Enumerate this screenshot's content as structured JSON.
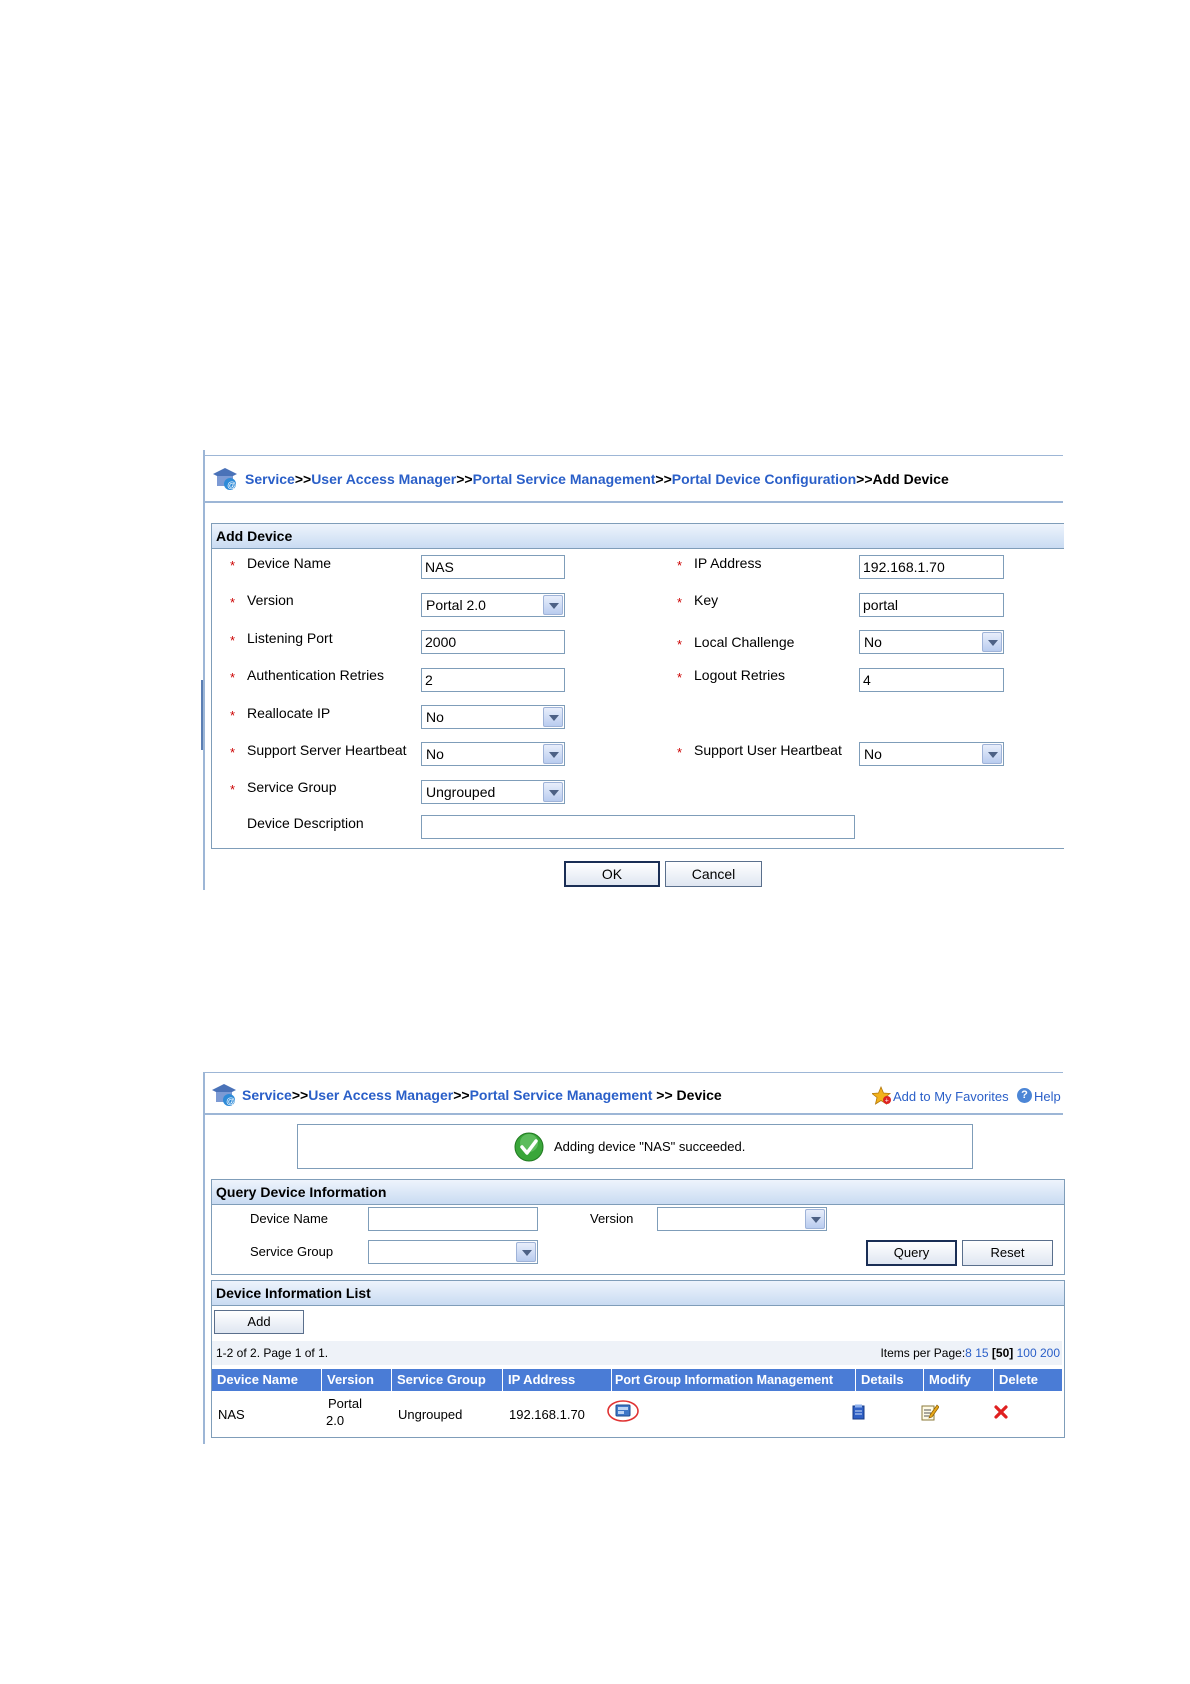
{
  "add_device_page": {
    "breadcrumb": [
      {
        "text": "Service",
        "link": true
      },
      {
        "text": ">>",
        "link": false
      },
      {
        "text": "User Access Manager",
        "link": true
      },
      {
        "text": ">>",
        "link": false
      },
      {
        "text": "Portal Service Management",
        "link": true
      },
      {
        "text": ">>",
        "link": false
      },
      {
        "text": "Portal Device Configuration",
        "link": true
      },
      {
        "text": ">>Add Device",
        "link": false
      }
    ],
    "section_title": "Add Device",
    "required_mark": "*",
    "fields": {
      "device_name": {
        "label": "Device Name",
        "value": "NAS"
      },
      "ip_address": {
        "label": "IP Address",
        "value": "192.168.1.70"
      },
      "version": {
        "label": "Version",
        "value": "Portal 2.0"
      },
      "key": {
        "label": "Key",
        "value": "portal"
      },
      "listening_port": {
        "label": "Listening Port",
        "value": "2000"
      },
      "local_challenge": {
        "label": "Local Challenge",
        "value": "No"
      },
      "auth_retries": {
        "label": "Authentication Retries",
        "value": "2"
      },
      "logout_retries": {
        "label": "Logout Retries",
        "value": "4"
      },
      "reallocate_ip": {
        "label": "Reallocate IP",
        "value": "No"
      },
      "server_heartbeat": {
        "label": "Support Server Heartbeat",
        "value": "No"
      },
      "user_heartbeat": {
        "label": "Support User Heartbeat",
        "value": "No"
      },
      "service_group": {
        "label": "Service Group",
        "value": "Ungrouped"
      },
      "description": {
        "label": "Device Description",
        "value": ""
      }
    },
    "ok_label": "OK",
    "cancel_label": "Cancel"
  },
  "device_page": {
    "breadcrumb": [
      {
        "text": "Service",
        "link": true
      },
      {
        "text": ">>",
        "link": false
      },
      {
        "text": "User Access Manager",
        "link": true
      },
      {
        "text": ">>",
        "link": false
      },
      {
        "text": "Portal Service Management",
        "link": true
      },
      {
        "text": " >> Device",
        "link": false
      }
    ],
    "favorites_label": "Add to My Favorites",
    "help_label": "Help",
    "success_message": "Adding device \"NAS\" succeeded.",
    "query": {
      "title": "Query Device Information",
      "device_name_label": "Device Name",
      "device_name_value": "",
      "version_label": "Version",
      "version_value": "",
      "service_group_label": "Service Group",
      "service_group_value": "",
      "query_label": "Query",
      "reset_label": "Reset"
    },
    "list": {
      "title": "Device Information List",
      "add_label": "Add",
      "summary": "1-2 of 2. Page 1 of 1.",
      "items_per_page_label": "Items per Page:",
      "page_sizes": [
        "8",
        "15",
        "[50]",
        "100",
        "200"
      ],
      "columns": [
        "Device Name",
        "Version",
        "Service Group",
        "IP Address",
        "Port Group Information Management",
        "Details",
        "Modify",
        "Delete"
      ],
      "rows": [
        {
          "device_name": "NAS",
          "version_line1": "Portal",
          "version_line2": "2.0",
          "service_group": "Ungrouped",
          "ip_address": "192.168.1.70"
        }
      ]
    }
  },
  "colors": {
    "link": "#2a5fc8",
    "header_blue": "#4a7cd6",
    "required": "#cc0000",
    "border": "#7f9db9"
  },
  "icons": [
    "app-logo-icon",
    "star-favorite-icon",
    "help-icon",
    "success-check-icon",
    "port-group-icon",
    "details-icon",
    "modify-icon",
    "delete-icon",
    "dropdown-arrow-icon"
  ]
}
